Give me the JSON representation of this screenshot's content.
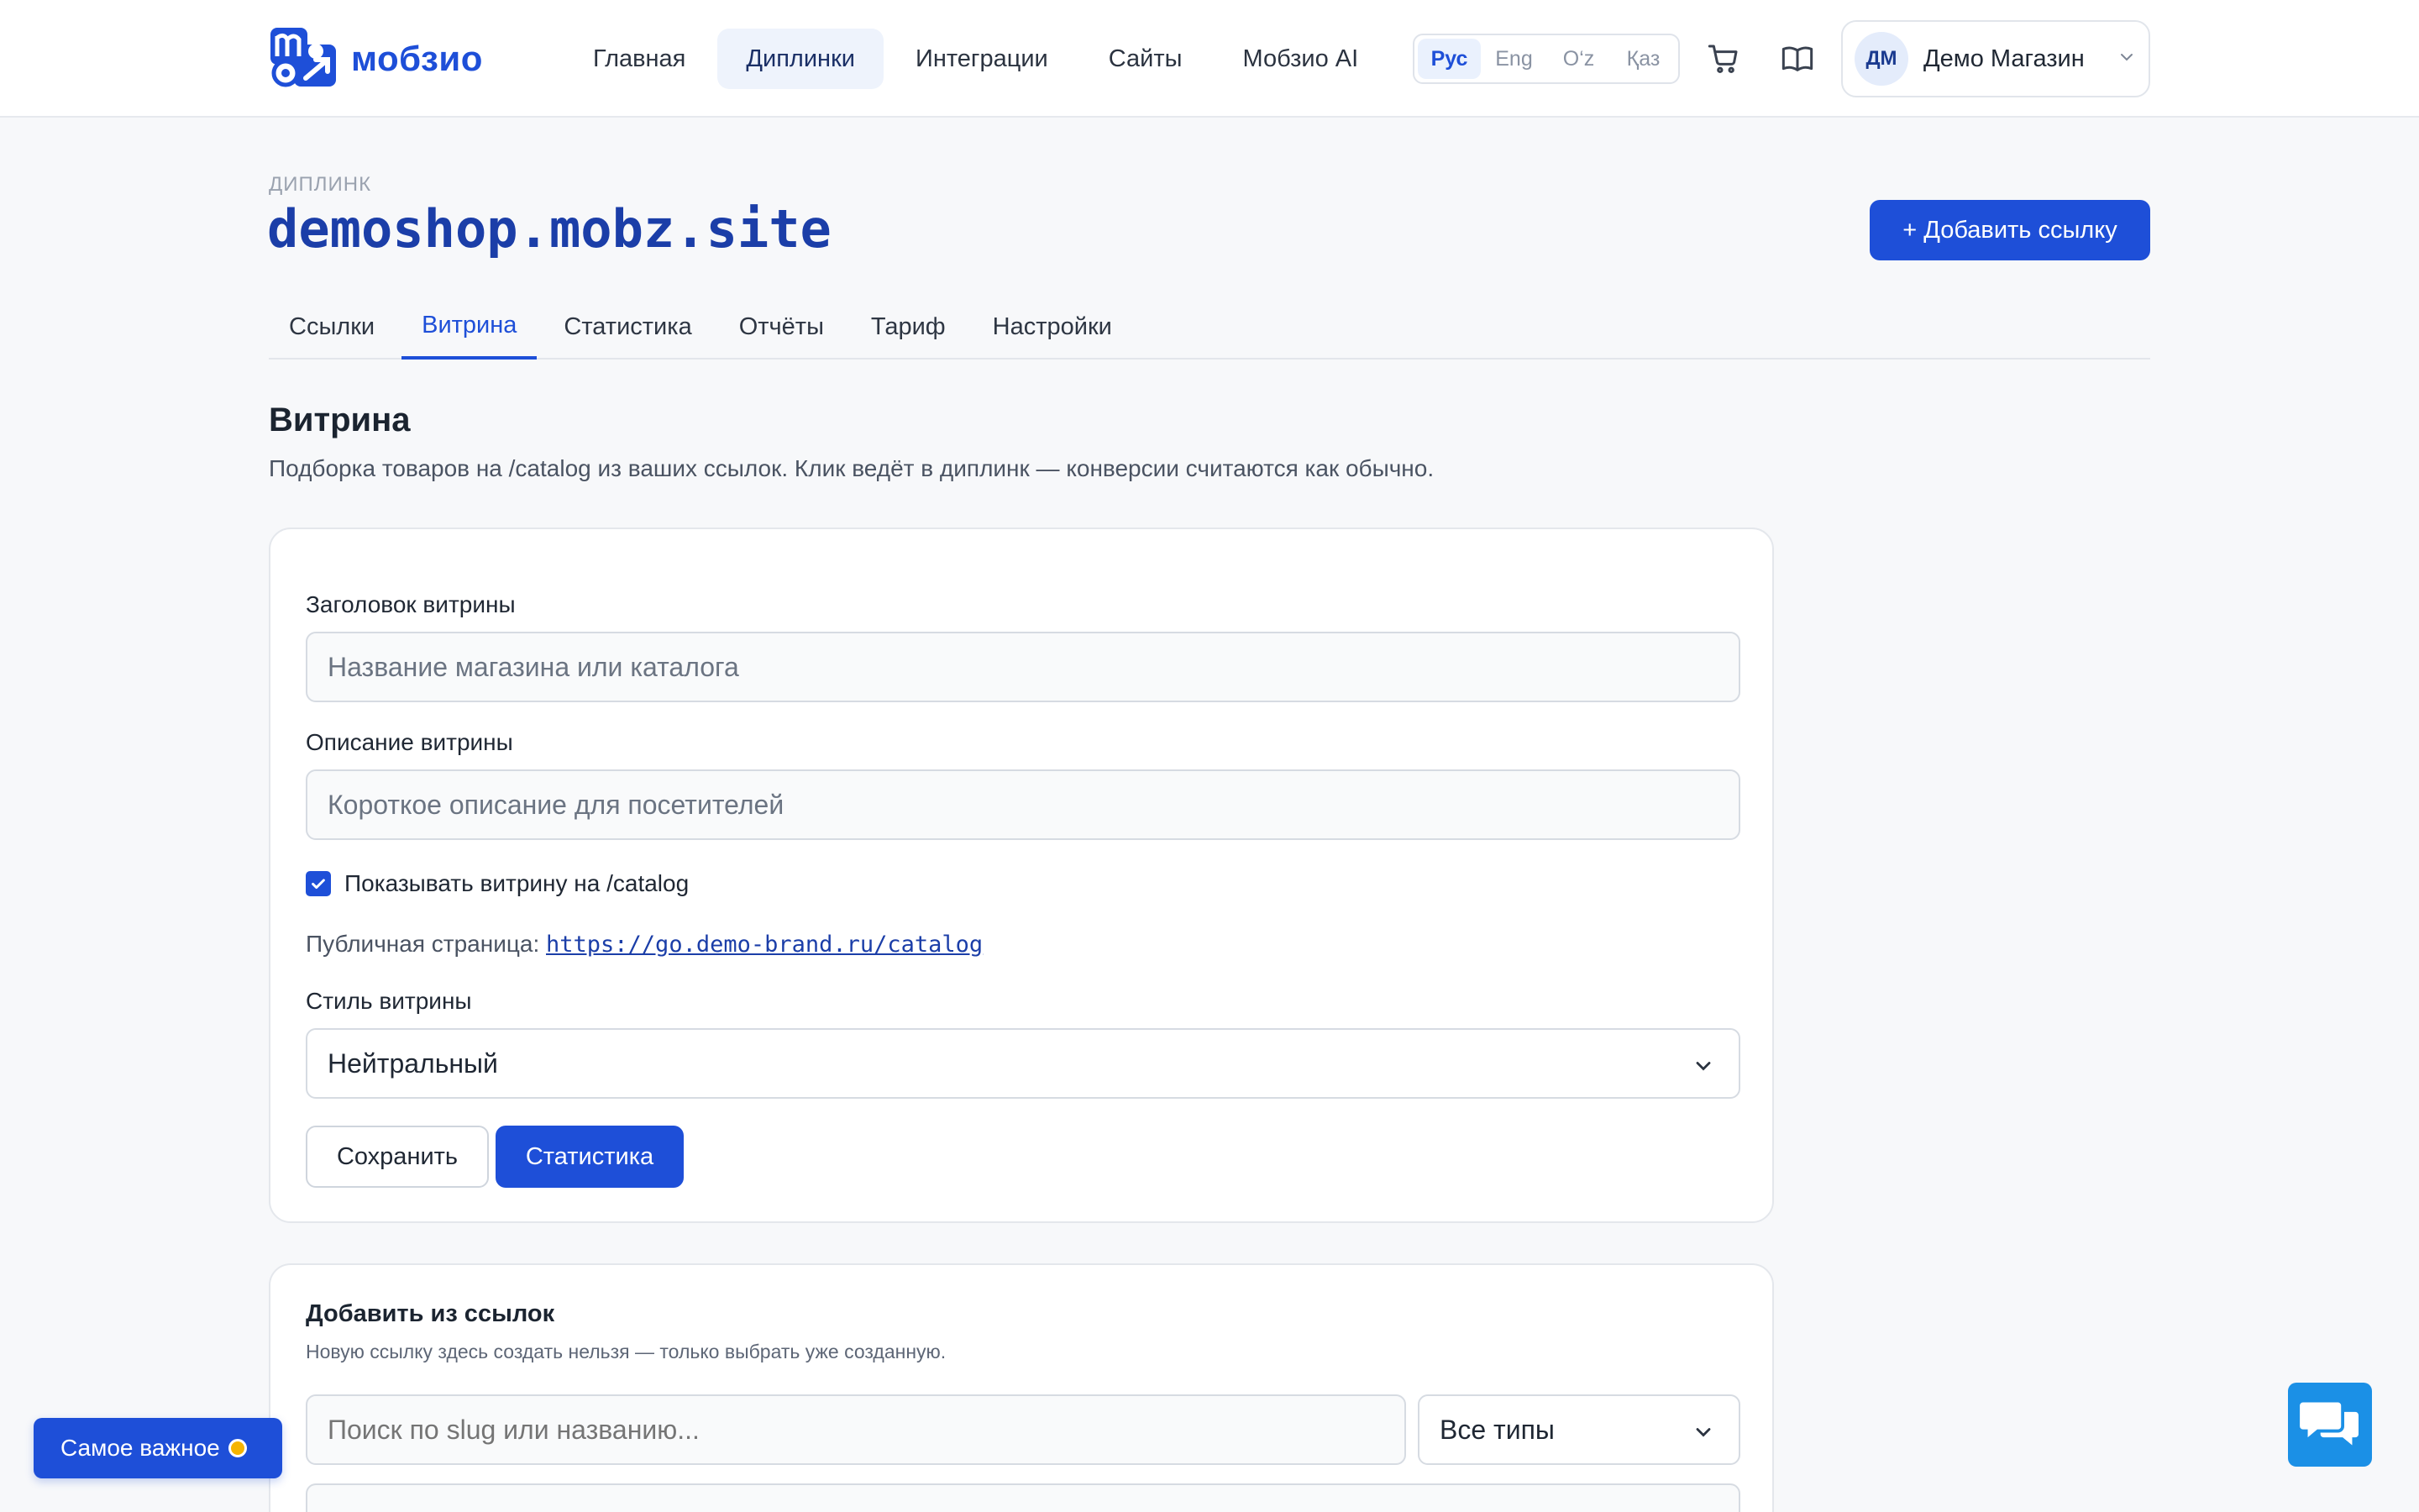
{
  "header": {
    "logo_text": "мобзио",
    "nav": [
      {
        "label": "Главная",
        "active": false
      },
      {
        "label": "Диплинки",
        "active": true
      },
      {
        "label": "Интеграции",
        "active": false
      },
      {
        "label": "Сайты",
        "active": false
      },
      {
        "label": "Мобзио AI",
        "active": false
      }
    ],
    "languages": [
      {
        "label": "Рус",
        "active": true
      },
      {
        "label": "Eng",
        "active": false
      },
      {
        "label": "O‘z",
        "active": false
      },
      {
        "label": "Қаз",
        "active": false
      }
    ],
    "icons": [
      "cart-icon",
      "book-icon"
    ],
    "account": {
      "initials": "ДМ",
      "name": "Демо Магазин"
    }
  },
  "page": {
    "eyebrow": "ДИПЛИНК",
    "title": "demoshop.mobz.site",
    "add_button": "+ Добавить ссылку",
    "tabs": [
      {
        "label": "Ссылки",
        "active": false
      },
      {
        "label": "Витрина",
        "active": true
      },
      {
        "label": "Статистика",
        "active": false
      },
      {
        "label": "Отчёты",
        "active": false
      },
      {
        "label": "Тариф",
        "active": false
      },
      {
        "label": "Настройки",
        "active": false
      }
    ]
  },
  "showcase": {
    "title": "Витрина",
    "description": "Подборка товаров на /catalog из ваших ссылок. Клик ведёт в диплинк — конверсии считаются как обычно.",
    "form": {
      "title_label": "Заголовок витрины",
      "title_placeholder": "Название магазина или каталога",
      "title_value": "",
      "desc_label": "Описание витрины",
      "desc_placeholder": "Короткое описание для посетителей",
      "desc_value": "",
      "show_checkbox_label": "Показывать витрину на /catalog",
      "show_checked": true,
      "public_label": "Публичная страница:",
      "public_url": "https://go.demo-brand.ru/catalog",
      "style_label": "Стиль витрины",
      "style_value": "Нейтральный",
      "save_button": "Сохранить",
      "stats_button": "Статистика"
    }
  },
  "add_from_links": {
    "title": "Добавить из ссылок",
    "description": "Новую ссылку здесь создать нельзя — только выбрать уже созданную.",
    "search_placeholder": "Поиск по slug или названию...",
    "type_value": "Все типы"
  },
  "floating": {
    "important_label": "Самое важное",
    "chat_icon": "chat-icon"
  },
  "colors": {
    "accent": "#1e4fd8",
    "title": "#1b3ea8",
    "badge_dot": "#f5b400",
    "chat": "#1b90e6"
  }
}
